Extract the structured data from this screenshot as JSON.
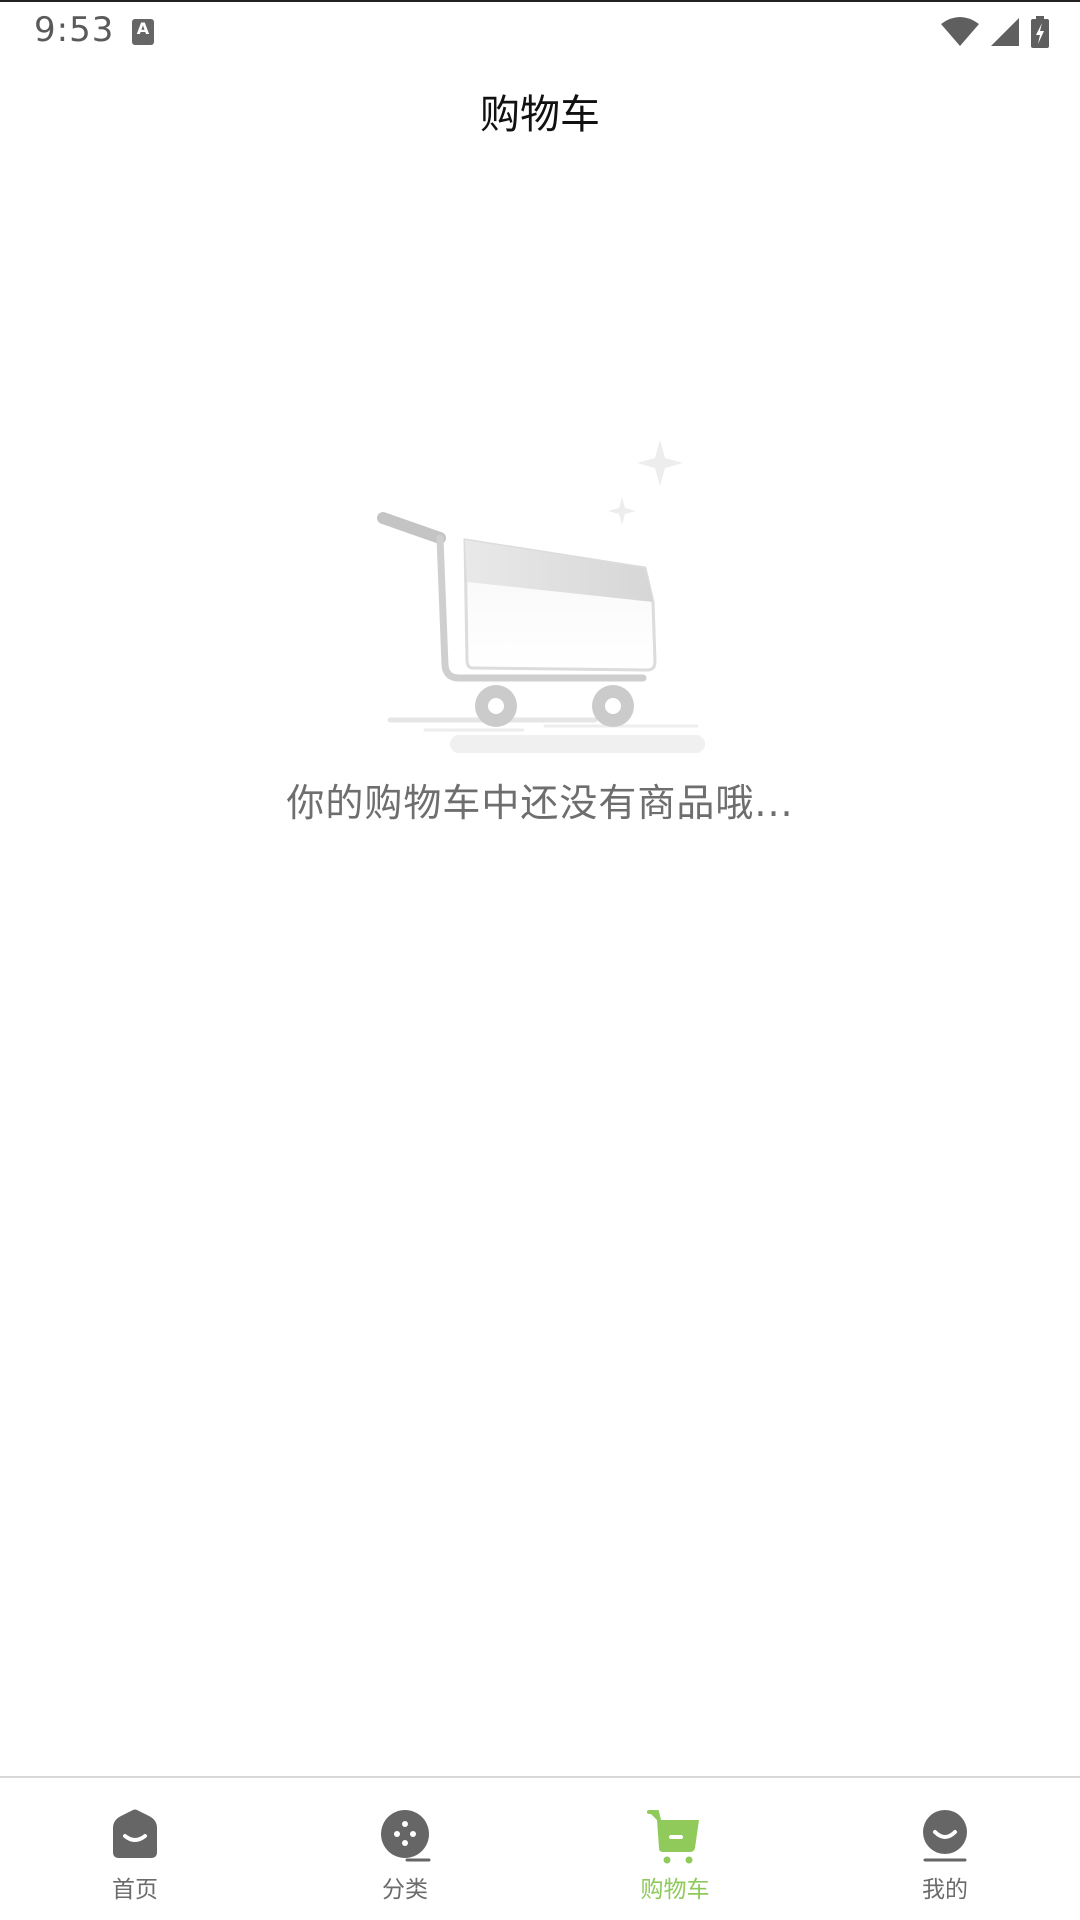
{
  "status_bar": {
    "time": "9:53",
    "notification_icon": "a-keyboard-icon",
    "wifi_icon": "wifi-icon",
    "signal_icon": "cell-signal-icon",
    "battery_icon": "battery-charging-icon"
  },
  "header": {
    "title": "购物车"
  },
  "empty_state": {
    "illustration_icon": "empty-cart-icon",
    "message": "你的购物车中还没有商品哦..."
  },
  "bottom_nav": {
    "active_color": "#8fca5b",
    "inactive_color": "#6b6b6b",
    "items": [
      {
        "label": "首页",
        "icon": "home-icon"
      },
      {
        "label": "分类",
        "icon": "category-icon"
      },
      {
        "label": "购物车",
        "icon": "cart-icon"
      },
      {
        "label": "我的",
        "icon": "profile-icon"
      }
    ],
    "active_index": 2
  }
}
